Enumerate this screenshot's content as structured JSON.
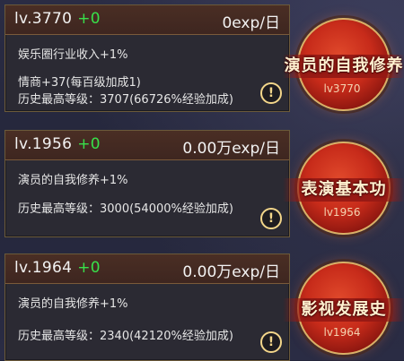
{
  "cards": [
    {
      "level": "lv.3770",
      "gain": "+0",
      "exp": "0exp/日",
      "lines": [
        "娱乐圈行业收入+1%",
        "情商+37(每百级加成1)",
        "历史最高等级：3707(66726%经验加成)"
      ],
      "badge_title": "演员的自我修养",
      "badge_level": "lv3770"
    },
    {
      "level": "lv.1956",
      "gain": "+0",
      "exp": "0.00万exp/日",
      "lines": [
        "演员的自我修养+1%",
        "历史最高等级：3000(54000%经验加成)"
      ],
      "badge_title": "表演基本功",
      "badge_level": "lv1956"
    },
    {
      "level": "lv.1964",
      "gain": "+0",
      "exp": "0.00万exp/日",
      "lines": [
        "演员的自我修养+1%",
        "历史最高等级：2340(42120%经验加成)"
      ],
      "badge_title": "影视发展史",
      "badge_level": "lv1964"
    }
  ],
  "icons": {
    "info": "exclamation-icon"
  },
  "colors": {
    "gain": "#38e04a",
    "accent": "#f3d68a",
    "badge": "#c72b1a"
  }
}
